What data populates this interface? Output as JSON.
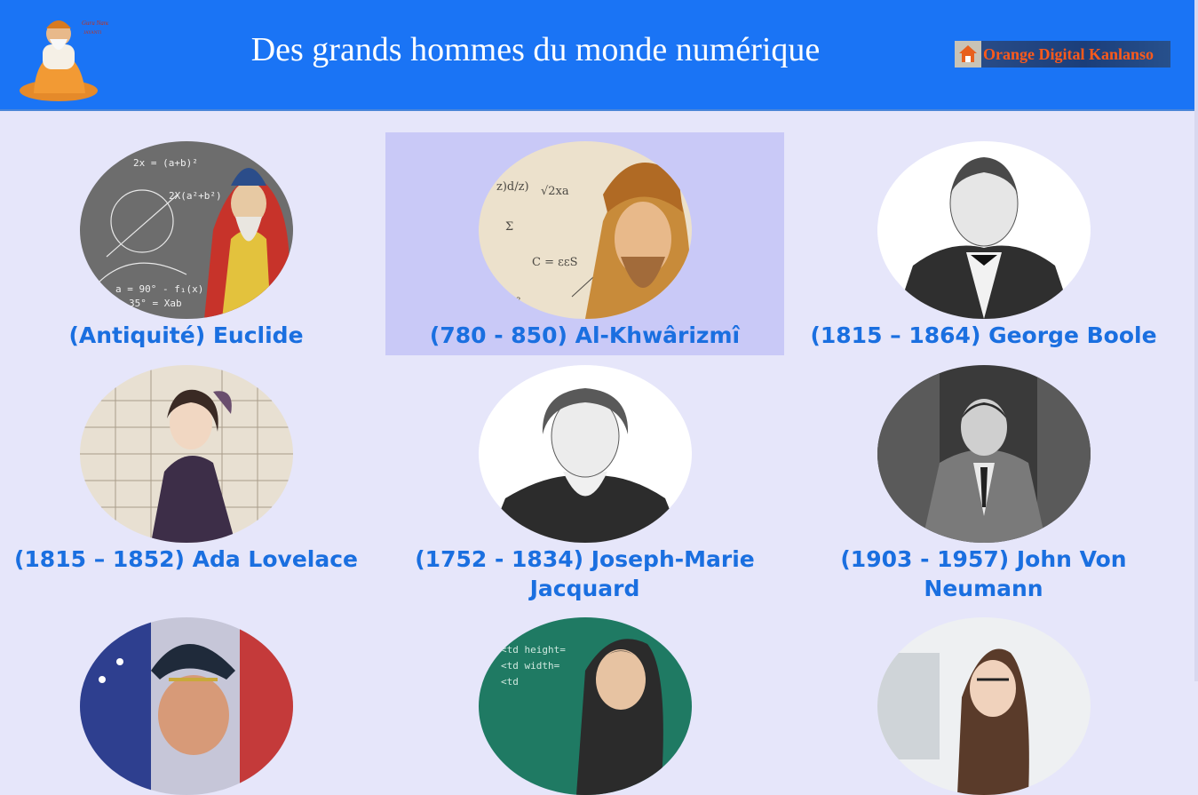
{
  "header": {
    "title": "Des grands hommes du monde numérique",
    "left_logo_icon": "guru-nanak-logo-icon",
    "brand": {
      "label": "Orange Digital Kanlanso",
      "icon": "orange-digital-logo-icon"
    }
  },
  "colors": {
    "header_bg": "#1a74f5",
    "page_bg": "#e6e6fa",
    "name_text": "#1a6fe0",
    "selected_bg": "#c9c9f7",
    "brand_text": "#ff5a1a"
  },
  "people": [
    {
      "label": "(Antiquité) Euclide",
      "icon": "euclide-portrait-icon"
    },
    {
      "label": "(780 - 850) Al-Khwârizmî",
      "icon": "al-khwarizmi-portrait-icon",
      "selected": true
    },
    {
      "label": "(1815 – 1864) George Boole",
      "icon": "george-boole-portrait-icon"
    },
    {
      "label": "(1815 – 1852) Ada Lovelace",
      "icon": "ada-lovelace-portrait-icon"
    },
    {
      "label": "(1752 - 1834) Joseph-Marie Jacquard",
      "icon": "jacquard-portrait-icon"
    },
    {
      "label": "(1903 - 1957) John Von Neumann",
      "icon": "von-neumann-portrait-icon"
    },
    {
      "label": "",
      "icon": "navy-officer-portrait-icon"
    },
    {
      "label": "",
      "icon": "html-man-portrait-icon"
    },
    {
      "label": "",
      "icon": "woman-computer-portrait-icon"
    }
  ]
}
